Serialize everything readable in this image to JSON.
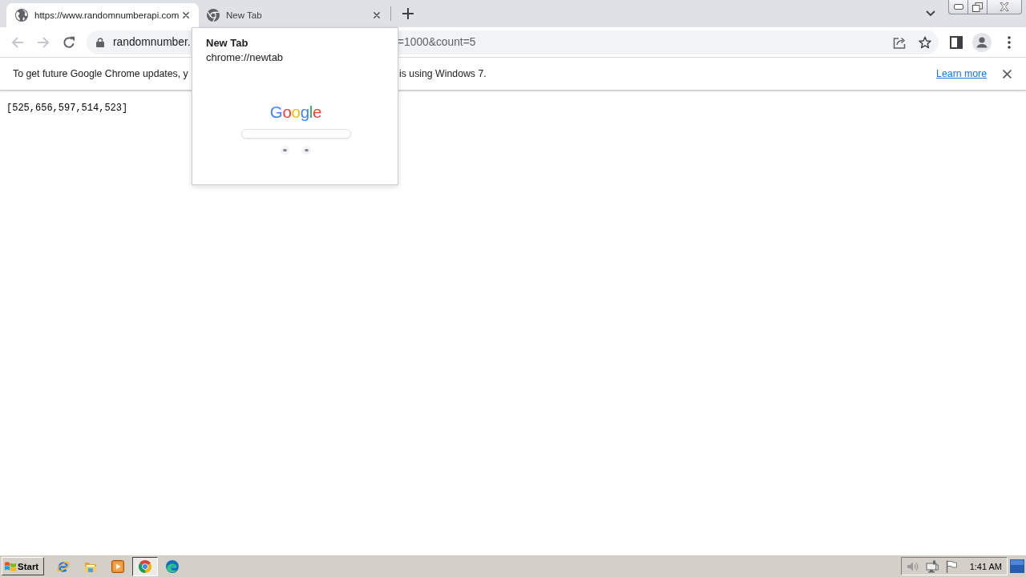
{
  "tab_strip": {
    "tabs": [
      {
        "kind": "web",
        "title": "https://www.randomnumberapi.com",
        "selected": true
      },
      {
        "kind": "app",
        "title": "New Tab",
        "selected": false
      }
    ]
  },
  "toolbar": {
    "nav_buttons": [
      {
        "kind": "back",
        "disabled": true
      },
      {
        "kind": "forward",
        "disabled": true
      },
      {
        "kind": "reload",
        "disabled": false
      }
    ],
    "address_bar": {
      "text_before_card": "randomnumber.",
      "text_after_card": "=1000&count=5"
    }
  },
  "infobar": {
    "message_before_card": "To get future Google Chrome updates, y",
    "message_after_card": "is using Windows 7.",
    "link": "Learn more"
  },
  "page": {
    "text": "[525,656,597,514,523]"
  },
  "tab_hover_card": {
    "title": "New Tab",
    "url": "chrome://newtab",
    "preview": {
      "logo": "Google"
    }
  },
  "taskbar": {
    "start": "Start",
    "apps": [
      {
        "kind": "ie",
        "selected": false
      },
      {
        "kind": "explorer",
        "selected": false
      },
      {
        "kind": "media",
        "selected": false
      },
      {
        "kind": "chrome",
        "selected": true
      },
      {
        "kind": "edge",
        "selected": false
      }
    ],
    "clock": "1:41 AM"
  }
}
